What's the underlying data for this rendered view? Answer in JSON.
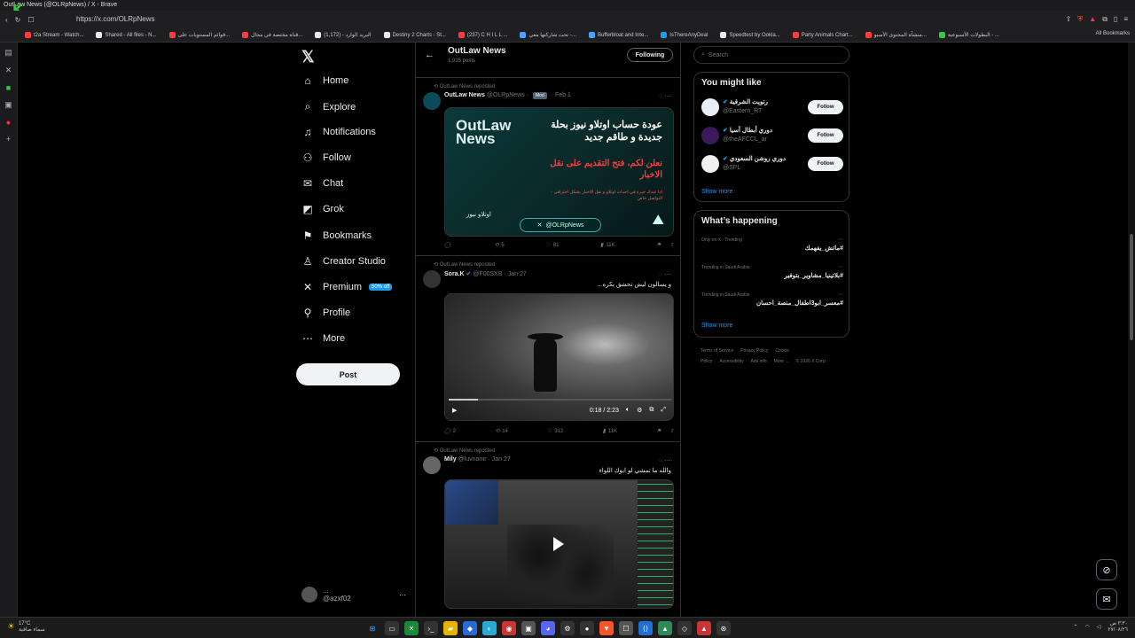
{
  "browser": {
    "title": "OutLaw News (@OLRpNews) / X - Brave",
    "url": "https://x.com/OLRpNews",
    "bookmarks": [
      {
        "label": "t2a Stream - Watch...",
        "color": "#ff3b3b"
      },
      {
        "label": "Shared - All files - N...",
        "color": "#e7e9ea"
      },
      {
        "label": "قوائم المستويات على...",
        "color": "#ff3b3b"
      },
      {
        "label": "قناة مختصة في مجال...",
        "color": "#ff3b3b"
      },
      {
        "label": "البريد الوارد - (1,172)",
        "color": "#e7e9ea"
      },
      {
        "label": "Destiny 2 Charts - St...",
        "color": "#e7e9ea"
      },
      {
        "label": "(237) C H I L L ...",
        "color": "#ff3b3b"
      },
      {
        "label": "تحت شاركتها معي -...",
        "color": "#4aa3ff"
      },
      {
        "label": "Bufferbloat and Inte...",
        "color": "#4aa3ff"
      },
      {
        "label": "IsThereAnyDeal",
        "color": "#1d9bf0"
      },
      {
        "label": "Speedtest by Ookla...",
        "color": "#e7e9ea"
      },
      {
        "label": "Party Animals Chart...",
        "color": "#ff3b3b"
      },
      {
        "label": "منشآة المحتوى الأسبو...",
        "color": "#ff3b3b"
      },
      {
        "label": "البطولات الأسبوعية - ...",
        "color": "#2ecc40"
      }
    ],
    "all_bookmarks": "All Bookmarks"
  },
  "nav": {
    "items": [
      {
        "label": "Home",
        "icon": "home-icon",
        "glyph": "⌂"
      },
      {
        "label": "Explore",
        "icon": "search-icon",
        "glyph": "⌕"
      },
      {
        "label": "Notifications",
        "icon": "bell-icon",
        "glyph": "♫"
      },
      {
        "label": "Follow",
        "icon": "person-add-icon",
        "glyph": "⚇"
      },
      {
        "label": "Chat",
        "icon": "mail-icon",
        "glyph": "✉"
      },
      {
        "label": "Grok",
        "icon": "grok-icon",
        "glyph": "◩"
      },
      {
        "label": "Bookmarks",
        "icon": "bookmark-icon",
        "glyph": "⚑"
      },
      {
        "label": "Creator Studio",
        "icon": "creator-icon",
        "glyph": "♙"
      },
      {
        "label": "Premium",
        "icon": "x-premium-icon",
        "glyph": "✕"
      },
      {
        "label": "Profile",
        "icon": "profile-icon",
        "glyph": "⚲"
      },
      {
        "label": "More",
        "icon": "more-circle-icon",
        "glyph": "⋯"
      }
    ],
    "premium_badge": "50% off",
    "post_label": "Post",
    "account_name": "...",
    "account_handle": "@azxf02"
  },
  "feed": {
    "title": "OutLaw News",
    "post_count": "1,915 posts",
    "following_label": "Following",
    "tweets": [
      {
        "reposted": "OutLaw News reposted",
        "name": "OutLaw News",
        "handle": "@OLRpNews",
        "badge": "Mod",
        "date": "Feb 1",
        "text": "",
        "replies": "",
        "reposts": "5",
        "likes": "81",
        "views": "11K"
      },
      {
        "reposted": "OutLaw News reposted",
        "name": "Sora.K",
        "handle": "@F00SXB",
        "date": "Jan 27",
        "text": "و يسالون ليش تحشق بكره...",
        "video_time": "0:18 / 2:23",
        "video_progress": 0.13,
        "replies": "2",
        "reposts": "14",
        "likes": "312",
        "views": "11K"
      },
      {
        "reposted": "OutLaw News reposted",
        "name": "Mily",
        "handle": "@luvnamr",
        "date": "Jan 27",
        "text": "والله ما تمشي لو ابوك اللواء"
      }
    ],
    "media1": {
      "brand": "OutLaw News",
      "headline": "عودة حساب اوتلاو نيوز بحلة جديدة و طاقم جديد",
      "cta": "نعلن لكم، فتح التقديم على نقل الاخبار",
      "small": "اذا عندك خبرة في احداث اوتلاو و نقل الاخبار بشكل احترافي - التواصل خاص",
      "signature": "اوتلاو نيوز",
      "handle": "@OLRpNews"
    }
  },
  "right": {
    "search_placeholder": "Search",
    "might_like_title": "You might like",
    "suggestions": [
      {
        "name": "رتويت الشرقية",
        "handle": "@Eastern_RT",
        "avatar_color": "#e8eef5",
        "follow": "Follow"
      },
      {
        "name": "دوري أبطال آسيا",
        "handle": "@theAFCCL_ar",
        "avatar_color": "#3a1a5a",
        "follow": "Follow"
      },
      {
        "name": "دوري روشن السعودي",
        "handle": "@SPL",
        "avatar_color": "#f0f0f0",
        "follow": "Follow"
      }
    ],
    "show_more": "Show more",
    "happening_title": "What’s happening",
    "trends": [
      {
        "context": "Only on X · Trending",
        "topic": "#ماتش_يفهمك"
      },
      {
        "context": "Trending in Saudi Arabia",
        "topic": "#بلاتينيا_مشاوير_بتوفير"
      },
      {
        "context": "Trending in Saudi Arabia",
        "topic": "#معسر_ابو3اطفال_منصة_احسان"
      }
    ],
    "footer": [
      "Terms of Service",
      "Privacy Policy",
      "Cookie Policy",
      "Accessibility",
      "Ads info",
      "More ...",
      "© 2026 X Corp."
    ]
  },
  "taskbar": {
    "temp": "17°C",
    "weather": "سماء صافية",
    "time": "٣:٣٠ ص",
    "date": "٢٧/٠٨/٢٦"
  },
  "colors": {
    "accent": "#1d9bf0",
    "bg": "#000000",
    "border": "#2f3336"
  }
}
